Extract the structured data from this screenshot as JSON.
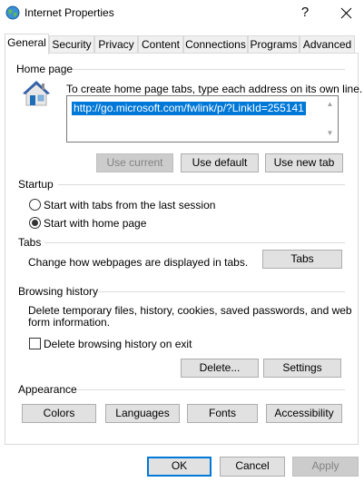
{
  "window": {
    "title": "Internet Properties",
    "help_glyph": "?"
  },
  "tabs": [
    "General",
    "Security",
    "Privacy",
    "Content",
    "Connections",
    "Programs",
    "Advanced"
  ],
  "active_tab": "General",
  "home_page": {
    "group_label": "Home page",
    "instruction": "To create home page tabs, type each address on its own line.",
    "address_value": "http://go.microsoft.com/fwlink/p/?LinkId=255141",
    "use_current": "Use current",
    "use_default": "Use default",
    "use_new_tab": "Use new tab"
  },
  "startup": {
    "group_label": "Startup",
    "option_last_session": "Start with tabs from the last session",
    "option_home_page": "Start with home page",
    "selected": "Start with home page"
  },
  "tabs_section": {
    "group_label": "Tabs",
    "description": "Change how webpages are displayed in tabs.",
    "button": "Tabs"
  },
  "browsing_history": {
    "group_label": "Browsing history",
    "description_line1": "Delete temporary files, history, cookies, saved passwords, and web",
    "description_line2": "form information.",
    "checkbox_label": "Delete browsing history on exit",
    "checkbox_checked": false,
    "delete_button": "Delete...",
    "settings_button": "Settings"
  },
  "appearance": {
    "group_label": "Appearance",
    "colors": "Colors",
    "languages": "Languages",
    "fonts": "Fonts",
    "accessibility": "Accessibility"
  },
  "footer": {
    "ok": "OK",
    "cancel": "Cancel",
    "apply": "Apply"
  },
  "colors": {
    "accent": "#0078d7",
    "button_face": "#e1e1e1",
    "disabled_text": "#838383"
  }
}
